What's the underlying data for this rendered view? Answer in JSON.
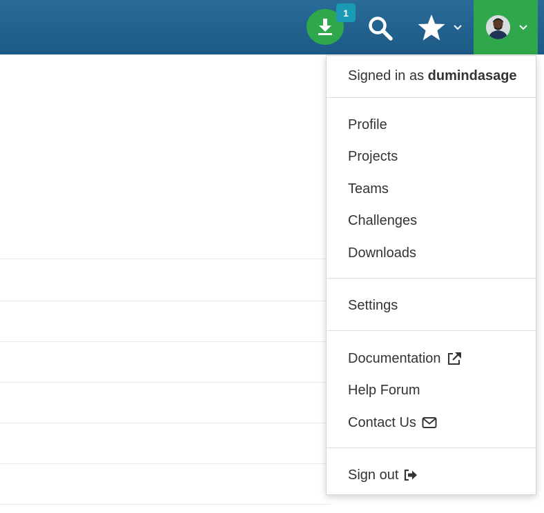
{
  "header": {
    "download_badge": "1",
    "icons": {
      "download": "download-icon",
      "search": "search-icon",
      "star": "star-icon",
      "avatar": "user-avatar",
      "chevron": "chevron-down-icon"
    },
    "colors": {
      "bar": "#1d5a86",
      "green": "#2ea84a",
      "badge": "#1a9ab5"
    }
  },
  "user_menu": {
    "signed_in_prefix": "Signed in as",
    "username": "dumindasage",
    "sections": [
      [
        "Profile",
        "Projects",
        "Teams",
        "Challenges",
        "Downloads"
      ],
      [
        "Settings"
      ],
      [
        "Documentation",
        "Help Forum",
        "Contact Us"
      ],
      [
        "Sign out"
      ]
    ],
    "item_icons": {
      "Documentation": "external-link-icon",
      "Contact Us": "envelope-icon",
      "Sign out": "sign-out-icon"
    }
  }
}
